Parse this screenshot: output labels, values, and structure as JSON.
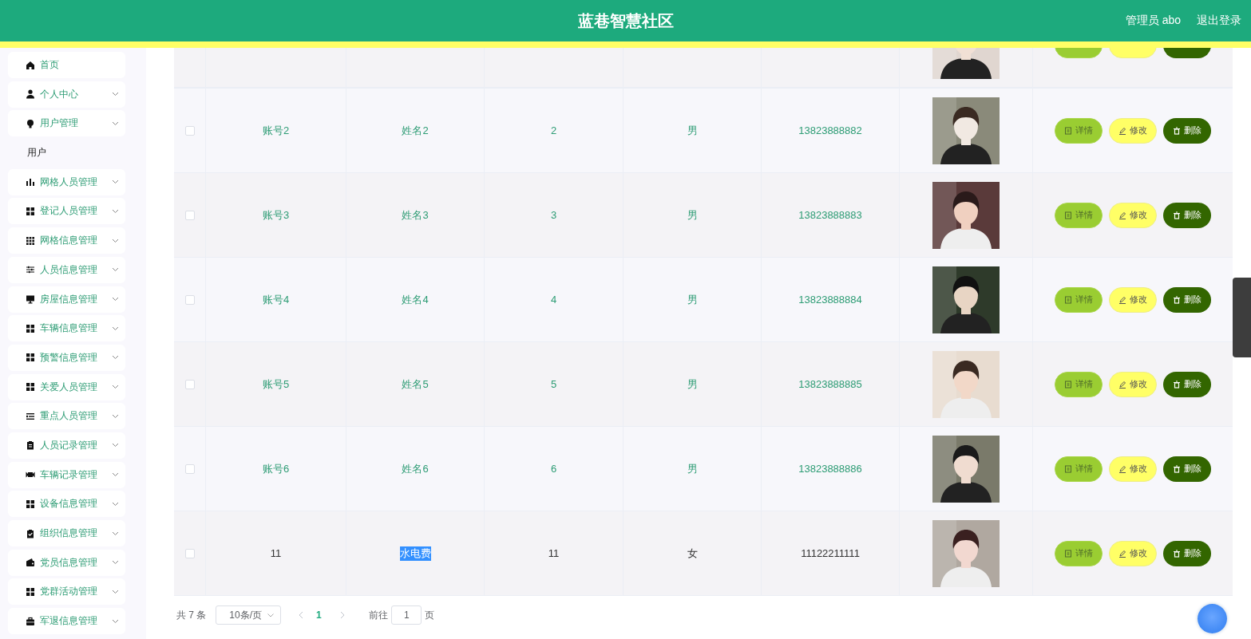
{
  "header": {
    "title": "蓝巷智慧社区",
    "user": "管理员 abo",
    "logout": "退出登录"
  },
  "sidebar": {
    "items": [
      {
        "label": "首页",
        "expandable": false
      },
      {
        "label": "个人中心",
        "expandable": true,
        "expanded": false
      },
      {
        "label": "用户管理",
        "expandable": true,
        "expanded": true,
        "children": [
          {
            "label": "用户"
          }
        ]
      },
      {
        "label": "网格人员管理",
        "expandable": true,
        "expanded": false
      },
      {
        "label": "登记人员管理",
        "expandable": true,
        "expanded": false
      },
      {
        "label": "网格信息管理",
        "expandable": true,
        "expanded": false
      },
      {
        "label": "人员信息管理",
        "expandable": true,
        "expanded": false
      },
      {
        "label": "房屋信息管理",
        "expandable": true,
        "expanded": false
      },
      {
        "label": "车辆信息管理",
        "expandable": true,
        "expanded": false
      },
      {
        "label": "预警信息管理",
        "expandable": true,
        "expanded": false
      },
      {
        "label": "关爱人员管理",
        "expandable": true,
        "expanded": false
      },
      {
        "label": "重点人员管理",
        "expandable": true,
        "expanded": false
      },
      {
        "label": "人员记录管理",
        "expandable": true,
        "expanded": false
      },
      {
        "label": "车辆记录管理",
        "expandable": true,
        "expanded": false
      },
      {
        "label": "设备信息管理",
        "expandable": true,
        "expanded": false
      },
      {
        "label": "组织信息管理",
        "expandable": true,
        "expanded": false
      },
      {
        "label": "党员信息管理",
        "expandable": true,
        "expanded": false
      },
      {
        "label": "党群活动管理",
        "expandable": true,
        "expanded": false
      },
      {
        "label": "军退信息管理",
        "expandable": true,
        "expanded": false
      }
    ]
  },
  "table": {
    "clipped_top_row": true,
    "rows": [
      {
        "checked": false,
        "dark_text": false,
        "cells": [
          "账号2",
          "姓名2",
          "2",
          "男",
          "13823888882"
        ],
        "photo": {
          "kind": "picture"
        },
        "actions": [
          {
            "kind": "detail",
            "label": "详情"
          },
          {
            "kind": "edit",
            "label": "修改"
          },
          {
            "kind": "delete",
            "label": "删除"
          }
        ]
      },
      {
        "checked": false,
        "dark_text": false,
        "cells": [
          "账号3",
          "姓名3",
          "3",
          "男",
          "13823888883"
        ],
        "photo": {
          "kind": "picture"
        },
        "actions": [
          {
            "kind": "detail",
            "label": "详情"
          },
          {
            "kind": "edit",
            "label": "修改"
          },
          {
            "kind": "delete",
            "label": "删除"
          }
        ]
      },
      {
        "checked": false,
        "dark_text": false,
        "cells": [
          "账号4",
          "姓名4",
          "4",
          "男",
          "13823888884"
        ],
        "photo": {
          "kind": "picture"
        },
        "actions": [
          {
            "kind": "detail",
            "label": "详情"
          },
          {
            "kind": "edit",
            "label": "修改"
          },
          {
            "kind": "delete",
            "label": "删除"
          }
        ]
      },
      {
        "checked": false,
        "dark_text": false,
        "cells": [
          "账号5",
          "姓名5",
          "5",
          "男",
          "13823888885"
        ],
        "photo": {
          "kind": "picture"
        },
        "actions": [
          {
            "kind": "detail",
            "label": "详情"
          },
          {
            "kind": "edit",
            "label": "修改"
          },
          {
            "kind": "delete",
            "label": "删除"
          }
        ]
      },
      {
        "checked": false,
        "dark_text": false,
        "cells": [
          "账号6",
          "姓名6",
          "6",
          "男",
          "13823888886"
        ],
        "photo": {
          "kind": "picture"
        },
        "actions": [
          {
            "kind": "detail",
            "label": "详情"
          },
          {
            "kind": "edit",
            "label": "修改"
          },
          {
            "kind": "delete",
            "label": "删除"
          }
        ]
      },
      {
        "checked": false,
        "dark_text": true,
        "highlighted_cells": [
          false,
          true,
          false,
          false,
          false
        ],
        "cells": [
          "11",
          "水电费",
          "11",
          "女",
          "11122211111"
        ],
        "photo": {
          "kind": "picture"
        },
        "actions": [
          {
            "kind": "detail",
            "label": "详情"
          },
          {
            "kind": "edit",
            "label": "修改"
          },
          {
            "kind": "delete",
            "label": "删除"
          }
        ]
      }
    ]
  },
  "pagination": {
    "total": "共 7 条",
    "page_size": "10条/页",
    "pages": [
      {
        "label": "1",
        "selected": true
      }
    ],
    "goto_label": "前往",
    "goto_value": "1",
    "goto_suffix": "页"
  }
}
